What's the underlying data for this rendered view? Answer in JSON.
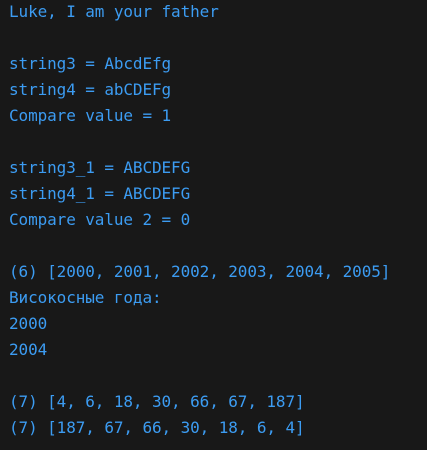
{
  "console": {
    "text_color": "#3c9cf2",
    "background": "#181818",
    "lines": [
      "Luke, I am your father",
      "",
      "string3 = AbcdEfg",
      "string4 = abCDEFg",
      "Compare value = 1",
      "",
      "string3_1 = ABCDEFG",
      "string4_1 = ABCDEFG",
      "Compare value 2 = 0",
      "",
      "(6) [2000, 2001, 2002, 2003, 2004, 2005]",
      "Високосные года:",
      "2000",
      "2004",
      "",
      "(7) [4, 6, 18, 30, 66, 67, 187]",
      "(7) [187, 67, 66, 30, 18, 6, 4]"
    ]
  }
}
